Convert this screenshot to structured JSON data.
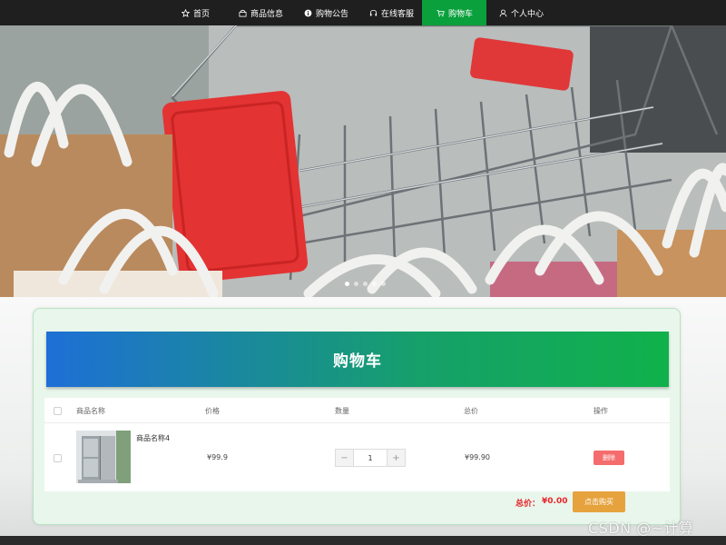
{
  "nav": {
    "items": [
      {
        "label": "首页",
        "icon": "star-icon"
      },
      {
        "label": "商品信息",
        "icon": "shop-icon"
      },
      {
        "label": "购物公告",
        "icon": "info-circle-icon"
      },
      {
        "label": "在线客服",
        "icon": "headset-icon"
      },
      {
        "label": "购物车",
        "icon": "cart-icon",
        "active": true
      },
      {
        "label": "个人中心",
        "icon": "user-icon"
      }
    ]
  },
  "cart": {
    "title": "购物车",
    "columns": {
      "name": "商品名称",
      "price": "价格",
      "quantity": "数量",
      "total": "总价",
      "action": "操作"
    },
    "rows": [
      {
        "name": "商品名称4",
        "price": "¥99.9",
        "quantity": "1",
        "total": "¥99.90",
        "delete_label": "删除"
      }
    ],
    "stepper": {
      "minus": "−",
      "plus": "+"
    },
    "total_label": "总价：",
    "total_value": "¥0.00",
    "buy_label": "点击购买"
  },
  "watermark": "CSDN @~计算",
  "colors": {
    "nav_bg": "#1f1f1f",
    "nav_active": "#0aa03c",
    "header_gradient_start": "#1e6fd6",
    "header_gradient_end": "#10b14b",
    "delete_button": "#f56c6c",
    "buy_button": "#e6a23c",
    "total_text": "#e8262a"
  }
}
